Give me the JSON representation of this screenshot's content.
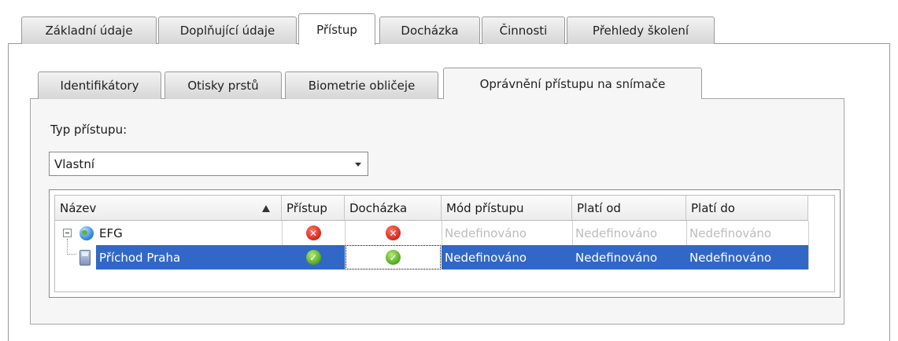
{
  "main_tabs": [
    {
      "label": "Základní údaje",
      "active": false
    },
    {
      "label": "Doplňující údaje",
      "active": false
    },
    {
      "label": "Přístup",
      "active": true
    },
    {
      "label": "Docházka",
      "active": false
    },
    {
      "label": "Činnosti",
      "active": false
    },
    {
      "label": "Přehledy školení",
      "active": false
    }
  ],
  "sub_tabs": [
    {
      "label": "Identifikátory",
      "active": false
    },
    {
      "label": "Otisky prstů",
      "active": false
    },
    {
      "label": "Biometrie obličeje",
      "active": false
    },
    {
      "label": "Oprávnění přístupu na snímače",
      "active": true
    }
  ],
  "access_type": {
    "label": "Typ přístupu:",
    "selected_value": "Vlastní"
  },
  "grid": {
    "columns": [
      "Název",
      "Přístup",
      "Docházka",
      "Mód přístupu",
      "Platí od",
      "Platí do"
    ],
    "sorted_column": "Název",
    "sort_direction": "ascending",
    "rows": [
      {
        "name": "EFG",
        "level": 0,
        "icon": "globe-icon",
        "expanded": true,
        "access": "denied-icon",
        "attendance": "denied-icon",
        "mode": "Nedefinováno",
        "valid_from": "Nedefinováno",
        "valid_to": "Nedefinováno",
        "selected": false
      },
      {
        "name": "Příchod Praha",
        "level": 1,
        "icon": "reader-device-icon",
        "access": "allowed-icon",
        "attendance": "allowed-icon",
        "mode": "Nedefinováno",
        "valid_from": "Nedefinováno",
        "valid_to": "Nedefinováno",
        "selected": true
      }
    ]
  },
  "colors": {
    "selection": "#3168c8",
    "muted_text": "#bcbcbc",
    "denied": "#d6241a",
    "allowed": "#4ea81c"
  }
}
